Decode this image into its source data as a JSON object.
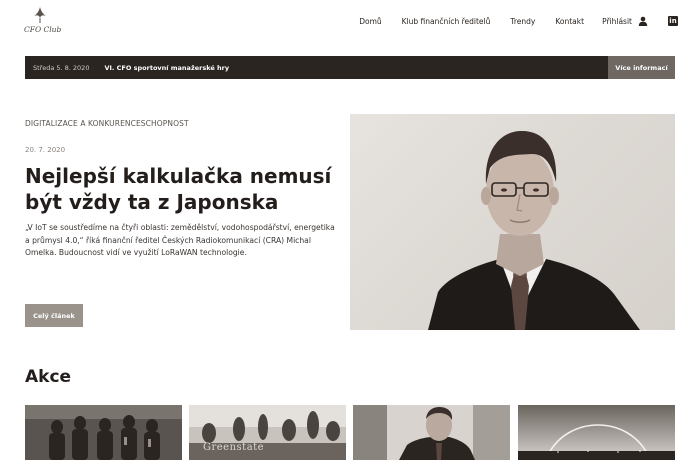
{
  "header": {
    "logo_text": "CFO Club",
    "nav": [
      {
        "label": "Domů"
      },
      {
        "label": "Klub finančních ředitelů"
      },
      {
        "label": "Trendy"
      },
      {
        "label": "Kontakt"
      },
      {
        "label": "Přihlásit"
      }
    ],
    "icons": {
      "login": "user-icon",
      "social": "linkedin-icon"
    }
  },
  "event_bar": {
    "date": "Středa 5. 8. 2020",
    "title": "VI. CFO sportovní manažerské hry",
    "more_label": "Více informací"
  },
  "article": {
    "category": "DIGITALIZACE A KONKURENCESCHOPNOST",
    "date": "20. 7. 2020",
    "title": "Nejlepší kalkulačka nemusí být vždy ta z Japonska",
    "excerpt": "„V IoT se soustředíme na čtyři oblasti: zemědělství, vodohospodářství, energetika a průmysl 4.0,“ říká finanční ředitel Českých Radiokomunikací (CRA) Michal Omelka. Budoucnost vidí ve využití LoRaWAN technologie.",
    "button_label": "Celý článek"
  },
  "events": {
    "heading": "Akce",
    "thumb_overlay_text": "Greenstate"
  },
  "colors": {
    "dark_bar": "#2b2522",
    "more_button": "#6e6762",
    "article_button": "#9a938c",
    "text": "#231e1b"
  }
}
